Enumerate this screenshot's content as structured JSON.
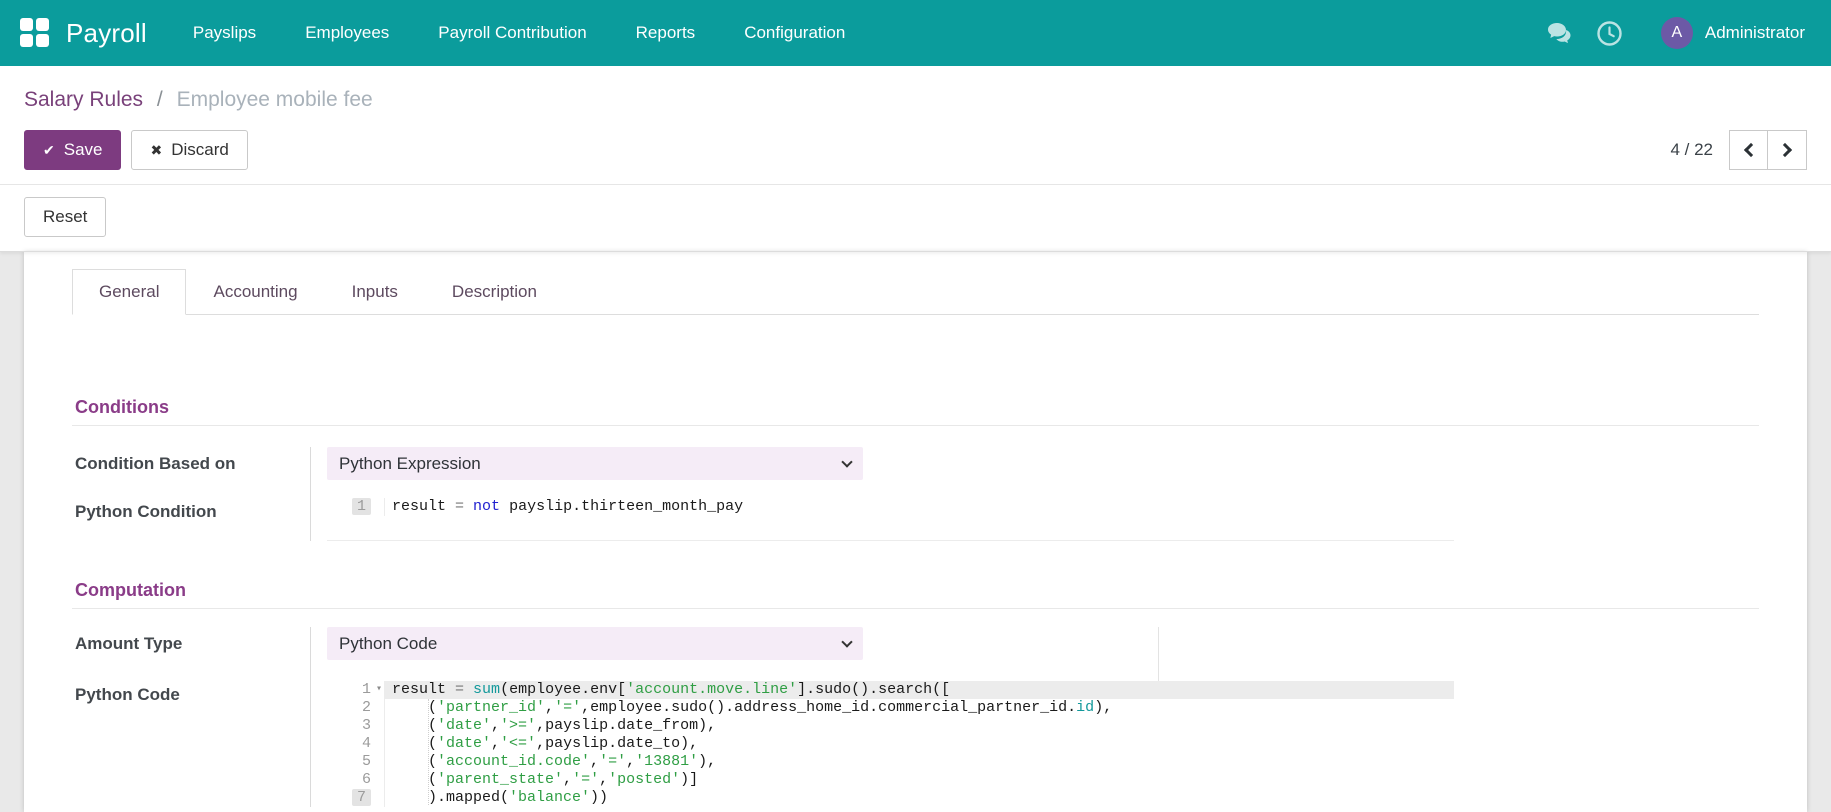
{
  "colors": {
    "header_teal": "#0b9c9c",
    "primary_purple": "#7d3b80",
    "breadcrumb_purple": "#79417a",
    "section_heading_purple": "#8a3c88",
    "select_bg": "#f5ecf7",
    "avatar_bg": "#6c59a6",
    "code_string_green": "#2f9e44",
    "code_keyword_blue": "#2020d0",
    "code_builtin_teal": "#13999b"
  },
  "icons": {
    "apps": "grid-of-squares",
    "messages": "chat-bubbles",
    "activities": "clock",
    "save_check": "✔",
    "discard_x": "✖",
    "pager_prev": "chevron-left",
    "pager_next": "chevron-right",
    "select_caret": "chevron-down",
    "code_fold": "▾"
  },
  "header": {
    "app_name": "Payroll",
    "menu_items": [
      "Payslips",
      "Employees",
      "Payroll Contribution",
      "Reports",
      "Configuration"
    ],
    "user": {
      "initial": "A",
      "name": "Administrator"
    }
  },
  "breadcrumb": {
    "parent": "Salary Rules",
    "separator": "/",
    "current": "Employee mobile fee"
  },
  "actions": {
    "save": "Save",
    "discard": "Discard",
    "reset": "Reset"
  },
  "pager": {
    "text": "4 / 22"
  },
  "tabs": [
    {
      "label": "General",
      "active": true
    },
    {
      "label": "Accounting",
      "active": false
    },
    {
      "label": "Inputs",
      "active": false
    },
    {
      "label": "Description",
      "active": false
    }
  ],
  "form": {
    "section1": {
      "title": "Conditions"
    },
    "section2": {
      "title": "Computation"
    },
    "condition_based_on": {
      "label": "Condition Based on",
      "value": "Python Expression"
    },
    "python_condition": {
      "label": "Python Condition",
      "lines": [
        {
          "n": "1",
          "chip": true,
          "active": false,
          "fold": false,
          "tokens": [
            [
              "p",
              "result "
            ],
            [
              "o",
              "="
            ],
            [
              "p",
              " "
            ],
            [
              "k",
              "not"
            ],
            [
              "p",
              " payslip.thirteen_month_pay"
            ]
          ]
        }
      ]
    },
    "amount_type": {
      "label": "Amount Type",
      "value": "Python Code"
    },
    "python_code": {
      "label": "Python Code",
      "lines": [
        {
          "n": "1",
          "chip": false,
          "active": true,
          "fold": true,
          "tokens": [
            [
              "p",
              "result "
            ],
            [
              "o",
              "="
            ],
            [
              "p",
              " "
            ],
            [
              "b",
              "sum"
            ],
            [
              "p",
              "(employee.env["
            ],
            [
              "s",
              "'account.move.line'"
            ],
            [
              "p",
              "].sudo().search(["
            ]
          ]
        },
        {
          "n": "2",
          "chip": false,
          "active": false,
          "fold": false,
          "tokens": [
            [
              "p",
              "    ("
            ],
            [
              "s",
              "'partner_id'"
            ],
            [
              "p",
              ","
            ],
            [
              "s",
              "'='"
            ],
            [
              "p",
              ",employee.sudo().address_home_id.commercial_partner_id."
            ],
            [
              "b",
              "id"
            ],
            [
              "p",
              "),"
            ]
          ]
        },
        {
          "n": "3",
          "chip": false,
          "active": false,
          "fold": false,
          "tokens": [
            [
              "p",
              "    ("
            ],
            [
              "s",
              "'date'"
            ],
            [
              "p",
              ","
            ],
            [
              "s",
              "'>='"
            ],
            [
              "p",
              ",payslip.date_from),"
            ]
          ]
        },
        {
          "n": "4",
          "chip": false,
          "active": false,
          "fold": false,
          "tokens": [
            [
              "p",
              "    ("
            ],
            [
              "s",
              "'date'"
            ],
            [
              "p",
              ","
            ],
            [
              "s",
              "'<='"
            ],
            [
              "p",
              ",payslip.date_to),"
            ]
          ]
        },
        {
          "n": "5",
          "chip": false,
          "active": false,
          "fold": false,
          "tokens": [
            [
              "p",
              "    ("
            ],
            [
              "s",
              "'account_id.code'"
            ],
            [
              "p",
              ","
            ],
            [
              "s",
              "'='"
            ],
            [
              "p",
              ","
            ],
            [
              "s",
              "'13881'"
            ],
            [
              "p",
              "),"
            ]
          ]
        },
        {
          "n": "6",
          "chip": false,
          "active": false,
          "fold": false,
          "tokens": [
            [
              "p",
              "    ("
            ],
            [
              "s",
              "'parent_state'"
            ],
            [
              "p",
              ","
            ],
            [
              "s",
              "'='"
            ],
            [
              "p",
              ","
            ],
            [
              "s",
              "'posted'"
            ],
            [
              "p",
              ")]"
            ]
          ]
        },
        {
          "n": "7",
          "chip": true,
          "active": false,
          "fold": false,
          "tokens": [
            [
              "p",
              "    ).mapped("
            ],
            [
              "s",
              "'balance'"
            ],
            [
              "p",
              "))"
            ]
          ]
        }
      ]
    }
  }
}
